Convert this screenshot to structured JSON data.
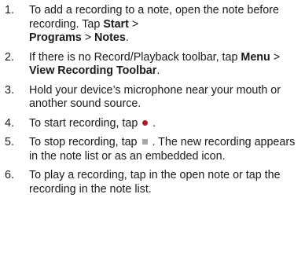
{
  "steps": [
    {
      "number": "1.",
      "parts": [
        "To add a recording to a note, open the note before recording. Tap ",
        "Start",
        " > ",
        "Programs",
        " > ",
        "Notes",
        "."
      ]
    },
    {
      "number": "2.",
      "parts": [
        "If there is no Record/Playback toolbar, tap ",
        "Menu",
        " > ",
        "View Recording Toolbar",
        "."
      ]
    },
    {
      "number": "3.",
      "text": "Hold your device’s microphone near your mouth or another sound source."
    },
    {
      "number": "4.",
      "before": "To start recording, tap",
      "after": ".",
      "icon": "record-icon",
      "icon_color": "#b01d2a"
    },
    {
      "number": "5.",
      "before": "To stop recording, tap",
      "after": ". The new recording appears in the note list or as an embedded icon.",
      "icon": "stop-icon",
      "icon_color": "#a8a8a8"
    },
    {
      "number": "6.",
      "text": "To play a recording, tap in the open note or tap the recording in the note list."
    }
  ]
}
